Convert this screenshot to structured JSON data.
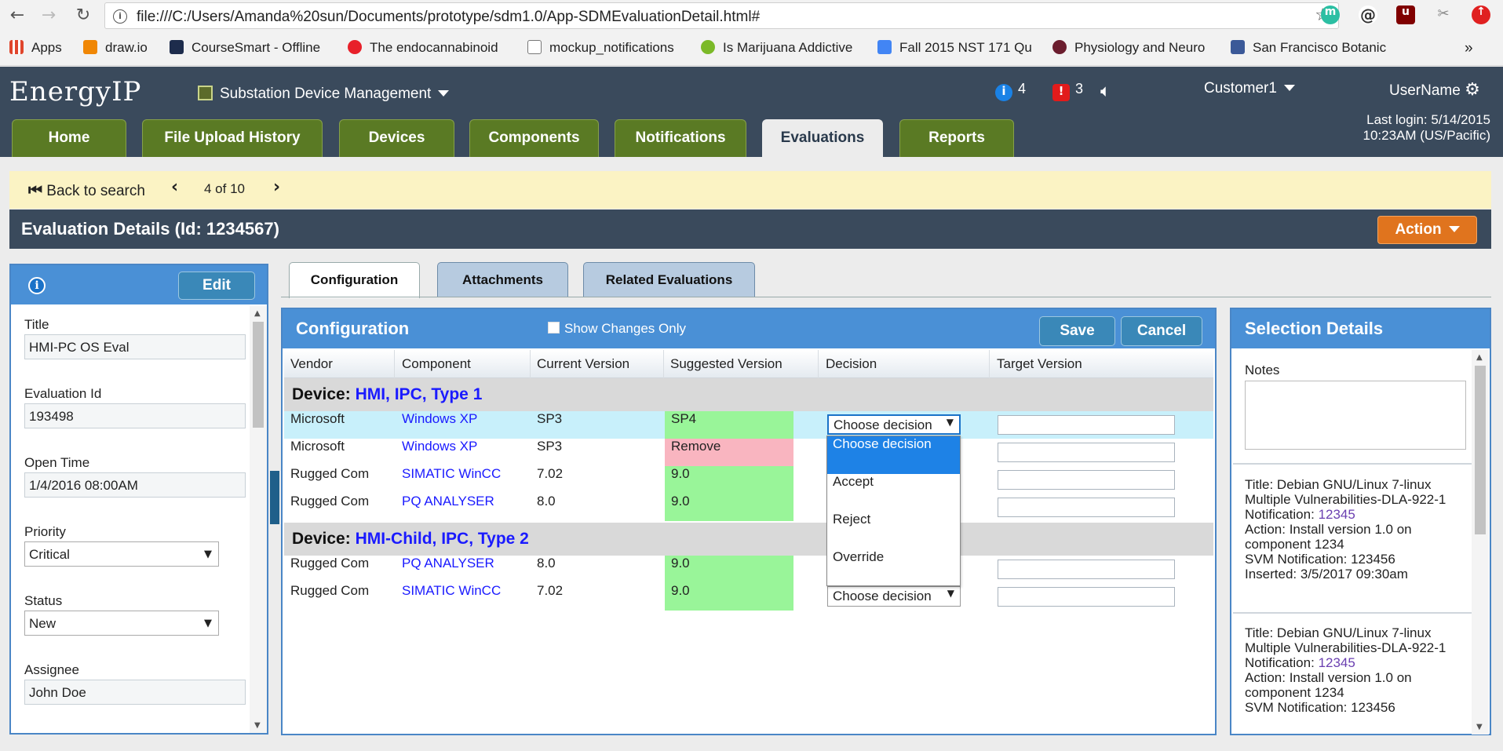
{
  "browser": {
    "url": "file:///C:/Users/Amanda%20sun/Documents/prototype/sdm1.0/App-SDMEvaluationDetail.html#",
    "bookmarks": [
      {
        "label": "Apps",
        "icon": "apps-grid-icon",
        "color": "#e0452c"
      },
      {
        "label": "draw.io",
        "icon": "drawio-icon",
        "color": "#f08705"
      },
      {
        "label": "CourseSmart - Offline",
        "icon": "coursesmart-icon",
        "color": "#1d2c4c"
      },
      {
        "label": "The endocannabinoid",
        "icon": "n-logo-icon",
        "color": "#e8202a"
      },
      {
        "label": "mockup_notifications",
        "icon": "document-icon",
        "color": "#777777"
      },
      {
        "label": "Is Marijuana Addictive",
        "icon": "dollar-badge-icon",
        "color": "#7bb928"
      },
      {
        "label": "Fall 2015 NST 171 Qu",
        "icon": "google-docs-icon",
        "color": "#4285f4"
      },
      {
        "label": "Physiology and Neuro",
        "icon": "aps-logo-icon",
        "color": "#6b1d2e"
      },
      {
        "label": "San Francisco Botanic",
        "icon": "facebook-icon",
        "color": "#3b5998"
      }
    ],
    "more_label": "»"
  },
  "app": {
    "logo": "EnergyIP",
    "module": "Substation Device Management",
    "info_count": "4",
    "alert_count": "3",
    "customer": "Customer1",
    "username": "UserName",
    "last_login_line1": "Last login: 5/14/2015",
    "last_login_line2": "10:23AM (US/Pacific)",
    "tabs": [
      "Home",
      "File Upload History",
      "Devices",
      "Components",
      "Notifications",
      "Evaluations",
      "Reports"
    ],
    "active_tab": "Evaluations"
  },
  "nav": {
    "back_label": "Back to search",
    "position": "4 of 10"
  },
  "page": {
    "title": "Evaluation Details (Id: 1234567)",
    "action_label": "Action"
  },
  "left_panel": {
    "edit_label": "Edit",
    "fields": {
      "title_label": "Title",
      "title_value": "HMI-PC OS Eval",
      "evalid_label": "Evaluation Id",
      "evalid_value": "193498",
      "opentime_label": "Open Time",
      "opentime_value": "1/4/2016 08:00AM",
      "priority_label": "Priority",
      "priority_value": "Critical",
      "status_label": "Status",
      "status_value": "New",
      "assignee_label": "Assignee",
      "assignee_value": "John Doe"
    }
  },
  "content_tabs": [
    "Configuration",
    "Attachments",
    "Related Evaluations"
  ],
  "config": {
    "title": "Configuration",
    "show_changes_label": "Show Changes Only",
    "save_label": "Save",
    "cancel_label": "Cancel",
    "columns": [
      "Vendor",
      "Component",
      "Current Version",
      "Suggested Version",
      "Decision",
      "Target Version"
    ],
    "device_prefix": "Device:",
    "devices": [
      {
        "name": "HMI, IPC, Type 1",
        "rows": [
          {
            "vendor": "Microsoft",
            "component": "Windows XP",
            "current": "SP3",
            "suggested": "SP4",
            "decision": "Choose decision",
            "status_color": "green"
          },
          {
            "vendor": "Microsoft",
            "component": "Windows XP",
            "current": "SP3",
            "suggested": "Remove",
            "decision": "",
            "status_color": "pink"
          },
          {
            "vendor": "Rugged Com",
            "component": "SIMATIC WinCC",
            "current": "7.02",
            "suggested": "9.0",
            "decision": "",
            "status_color": "green"
          },
          {
            "vendor": "Rugged Com",
            "component": "PQ ANALYSER",
            "current": "8.0",
            "suggested": "9.0",
            "decision": "",
            "status_color": "green"
          }
        ]
      },
      {
        "name": "HMI-Child, IPC, Type 2",
        "rows": [
          {
            "vendor": "Rugged Com",
            "component": "PQ ANALYSER",
            "current": "8.0",
            "suggested": "9.0",
            "decision": "",
            "status_color": "green"
          },
          {
            "vendor": "Rugged Com",
            "component": "SIMATIC WinCC",
            "current": "7.02",
            "suggested": "9.0",
            "decision": "Choose decision",
            "status_color": "green"
          }
        ]
      }
    ],
    "dropdown_options": [
      "Choose decision",
      "Accept",
      "Reject",
      "Override"
    ],
    "dropdown_selected": "Choose decision"
  },
  "selection_details": {
    "title": "Selection Details",
    "notes_label": "Notes",
    "cards": [
      {
        "title": "Title: Debian GNU/Linux 7-linux",
        "title2": "Multiple Vulnerabilities-DLA-922-1",
        "notification_label": "Notification:",
        "notification": "12345",
        "action1": "Action: Install version 1.0 on",
        "action2": "component 1234",
        "svm": "SVM Notification: 123456",
        "inserted": "Inserted: 3/5/2017 09:30am"
      },
      {
        "title": "Title: Debian GNU/Linux 7-linux",
        "title2": "Multiple Vulnerabilities-DLA-922-1",
        "notification_label": "Notification:",
        "notification": "12345",
        "action1": "Action: Install version 1.0 on",
        "action2": "component 1234",
        "svm": "SVM Notification: 123456"
      }
    ]
  }
}
